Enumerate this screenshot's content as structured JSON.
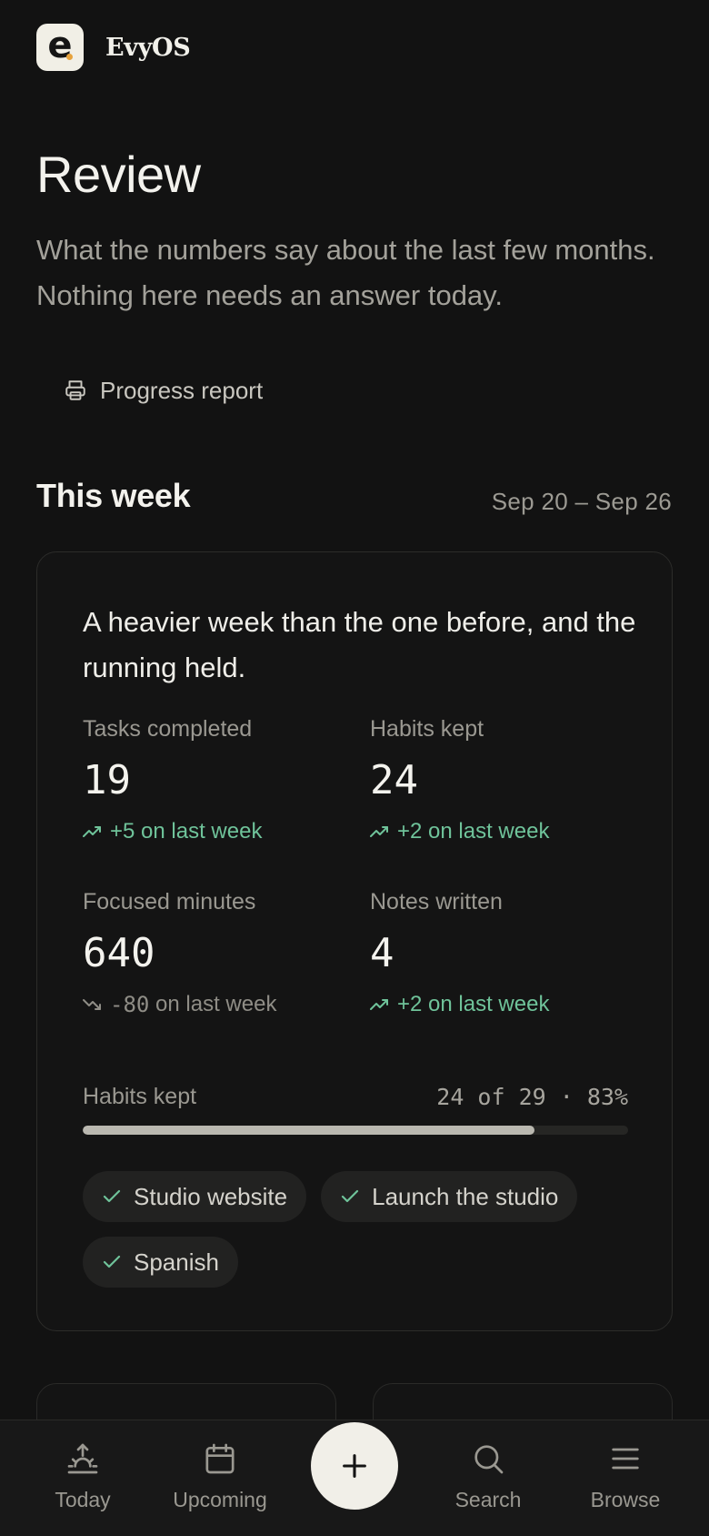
{
  "app": {
    "name": "EvyOS",
    "logo_letter": "e"
  },
  "header": {
    "title": "Review",
    "subtitle": "What the numbers say about the last few months. Nothing here needs an answer today."
  },
  "actions": {
    "report_label": "Progress report"
  },
  "week": {
    "section_title": "This week",
    "date_range": "Sep 20 – Sep 26",
    "summary": "A heavier week than the one before, and the running held.",
    "stats": [
      {
        "label": "Tasks completed",
        "value": "19",
        "delta": "+5",
        "delta_suffix": "on last week",
        "trend": "up"
      },
      {
        "label": "Habits kept",
        "value": "24",
        "delta": "+2",
        "delta_suffix": "on last week",
        "trend": "up"
      },
      {
        "label": "Focused minutes",
        "value": "640",
        "delta": "-80",
        "delta_suffix": "on last week",
        "trend": "down"
      },
      {
        "label": "Notes written",
        "value": "4",
        "delta": "+2",
        "delta_suffix": "on last week",
        "trend": "up"
      }
    ],
    "habits_progress": {
      "label": "Habits kept",
      "text": "24 of 29 · 83%",
      "kept": 24,
      "total": 29,
      "percent": 83
    },
    "chips": [
      "Studio website",
      "Launch the studio",
      "Spanish"
    ]
  },
  "nav": {
    "items": [
      {
        "label": "Today",
        "icon": "sunrise-icon"
      },
      {
        "label": "Upcoming",
        "icon": "calendar-icon"
      },
      {
        "label": "Search",
        "icon": "search-icon"
      },
      {
        "label": "Browse",
        "icon": "menu-icon"
      }
    ],
    "fab_icon": "plus-icon"
  },
  "colors": {
    "background": "#121212",
    "positive": "#6fc39a",
    "muted": "#9a9891",
    "fab": "#f1efe8"
  }
}
